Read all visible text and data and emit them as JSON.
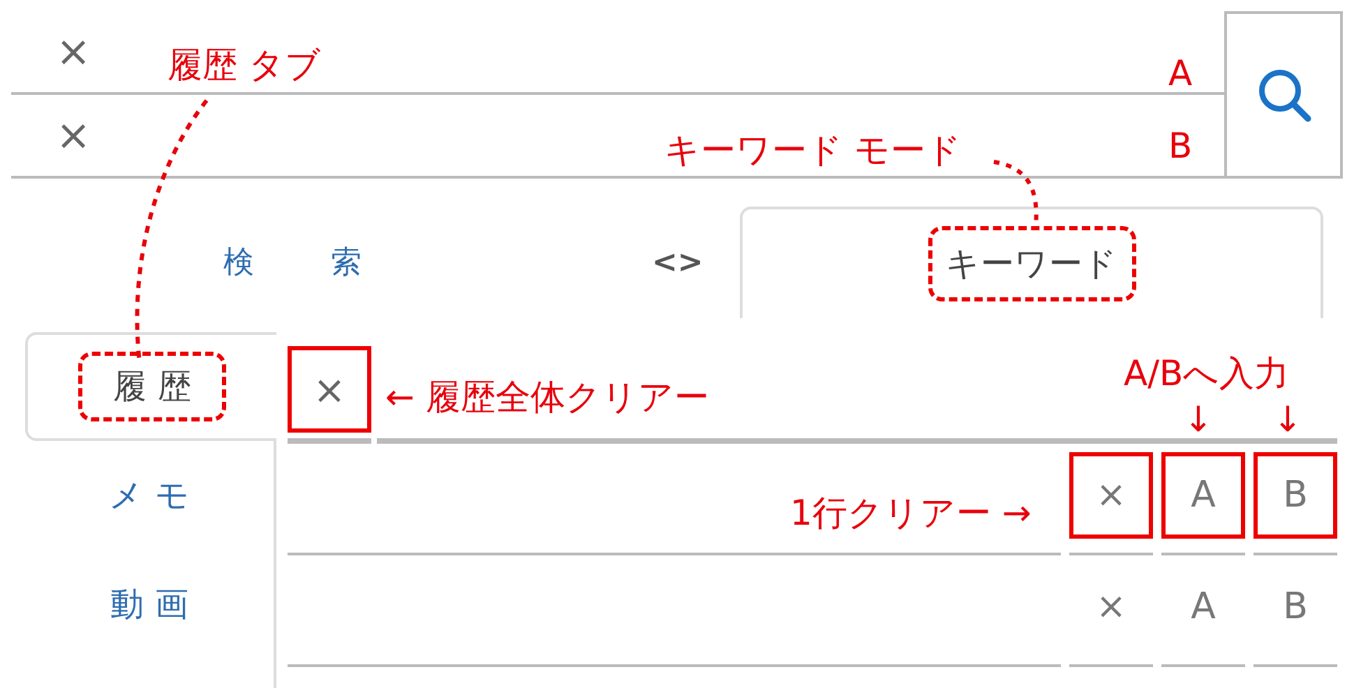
{
  "inputs": [
    {
      "clear_icon": "×"
    },
    {
      "clear_icon": "×"
    }
  ],
  "mode_tabs": {
    "search_label": "検 索",
    "toggle": "<>",
    "keyword_tab": {
      "label": "キーワード",
      "outlined": true
    }
  },
  "side_tabs": [
    {
      "label": "履 歴",
      "selected": true,
      "outlined": true
    },
    {
      "label": "メ モ",
      "selected": false,
      "outlined": false
    },
    {
      "label": "動 画",
      "selected": false,
      "outlined": false
    }
  ],
  "history": {
    "clear_all": {
      "label": "×",
      "outlined": true
    },
    "rows": [
      {
        "buttons": [
          "×",
          "A",
          "B"
        ],
        "outlined": true
      },
      {
        "buttons": [
          "×",
          "A",
          "B"
        ],
        "outlined": false
      }
    ]
  },
  "annotations": [
    {
      "text": "履歴 タブ"
    },
    {
      "text": "A"
    },
    {
      "text": "B"
    },
    {
      "text": "キーワード モード"
    },
    {
      "text": "← 履歴全体クリアー"
    },
    {
      "text": "A/Bへ入力"
    },
    {
      "text": "↓"
    },
    {
      "text": "↓"
    },
    {
      "text": "1行クリアー →"
    }
  ]
}
